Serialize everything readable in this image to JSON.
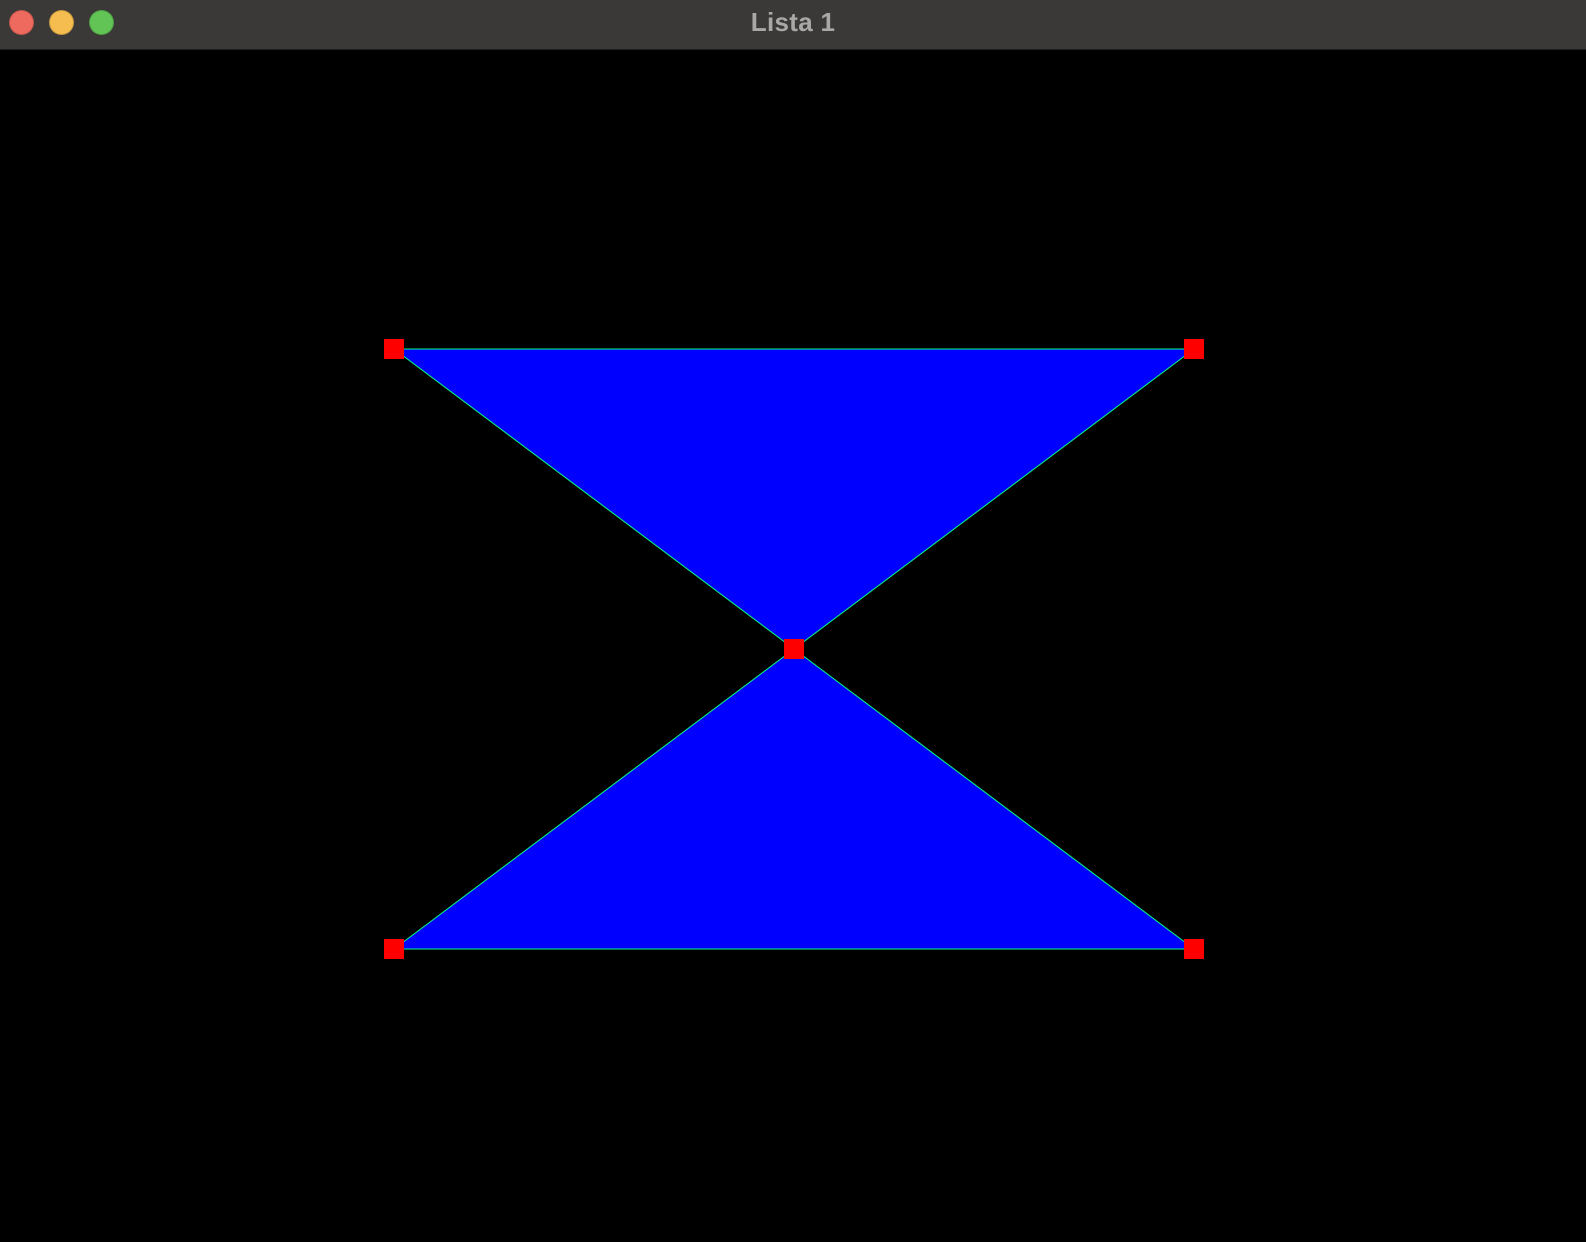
{
  "window": {
    "title": "Lista 1",
    "controls": {
      "close_color": "#ee6a5f",
      "minimize_color": "#f5bd4f",
      "zoom_color": "#61c454"
    }
  },
  "canvas": {
    "background_color": "#000000",
    "fill_color": "#0000ff",
    "edge_color": "#00ff88",
    "vertex_color": "#ff0000",
    "shape": "two triangles meeting at a shared center vertex (hourglass)"
  }
}
